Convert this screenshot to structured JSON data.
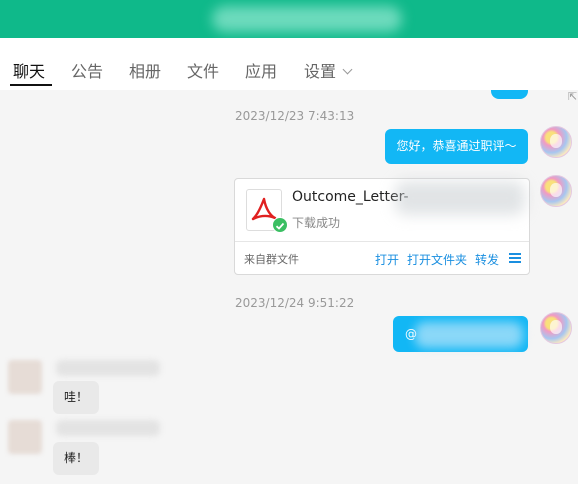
{
  "tabs": [
    "聊天",
    "公告",
    "相册",
    "文件",
    "应用",
    "设置"
  ],
  "colors": {
    "title_bar": "#0fb98a",
    "bubble_out": "#12b7f5",
    "link": "#1a8fe0"
  },
  "chat": {
    "timestamp_1": "2023/12/23 7:43:13",
    "msg_out_1": "您好，恭喜通过职评～",
    "file": {
      "name": "Outcome_Letter-",
      "status": "下载成功",
      "source": "来自群文件",
      "actions": [
        "打开",
        "打开文件夹",
        "转发"
      ],
      "icon": "pdf-icon",
      "status_icon": "check-icon",
      "menu_icon": "menu-icon"
    },
    "timestamp_2": "2023/12/24 9:51:22",
    "msg_out_2": "@",
    "msg_in_1": "哇！",
    "msg_in_2": "棒！"
  }
}
